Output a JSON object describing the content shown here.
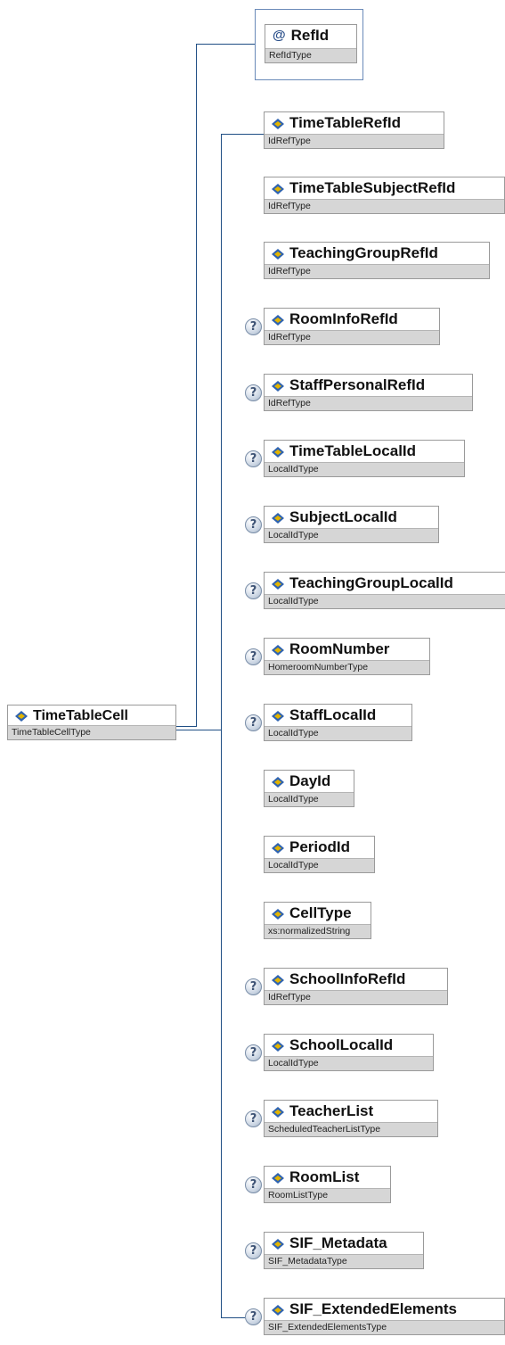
{
  "root": {
    "name": "TimeTableCell",
    "type": "TimeTableCellType",
    "icon": "element-icon"
  },
  "attribute": {
    "name": "RefId",
    "type": "RefIdType",
    "symbol": "@",
    "icon": "attribute-icon"
  },
  "children": [
    {
      "name": "TimeTableRefId",
      "type": "IdRefType",
      "optional": false
    },
    {
      "name": "TimeTableSubjectRefId",
      "type": "IdRefType",
      "optional": false
    },
    {
      "name": "TeachingGroupRefId",
      "type": "IdRefType",
      "optional": false
    },
    {
      "name": "RoomInfoRefId",
      "type": "IdRefType",
      "optional": true
    },
    {
      "name": "StaffPersonalRefId",
      "type": "IdRefType",
      "optional": true
    },
    {
      "name": "TimeTableLocalId",
      "type": "LocalIdType",
      "optional": true
    },
    {
      "name": "SubjectLocalId",
      "type": "LocalIdType",
      "optional": true
    },
    {
      "name": "TeachingGroupLocalId",
      "type": "LocalIdType",
      "optional": true
    },
    {
      "name": "RoomNumber",
      "type": "HomeroomNumberType",
      "optional": true
    },
    {
      "name": "StaffLocalId",
      "type": "LocalIdType",
      "optional": true
    },
    {
      "name": "DayId",
      "type": "LocalIdType",
      "optional": false
    },
    {
      "name": "PeriodId",
      "type": "LocalIdType",
      "optional": false
    },
    {
      "name": "CellType",
      "type": "xs:normalizedString",
      "optional": false
    },
    {
      "name": "SchoolInfoRefId",
      "type": "IdRefType",
      "optional": true
    },
    {
      "name": "SchoolLocalId",
      "type": "LocalIdType",
      "optional": true
    },
    {
      "name": "TeacherList",
      "type": "ScheduledTeacherListType",
      "optional": true
    },
    {
      "name": "RoomList",
      "type": "RoomListType",
      "optional": true
    },
    {
      "name": "SIF_Metadata",
      "type": "SIF_MetadataType",
      "optional": true
    },
    {
      "name": "SIF_ExtendedElements",
      "type": "SIF_ExtendedElementsType",
      "optional": true
    }
  ],
  "optional_marker": "?",
  "colors": {
    "connector": "#1f4e84",
    "type_bar": "#d6d6d6",
    "icon_blue": "#2f63b0",
    "icon_gold": "#e2b400"
  }
}
